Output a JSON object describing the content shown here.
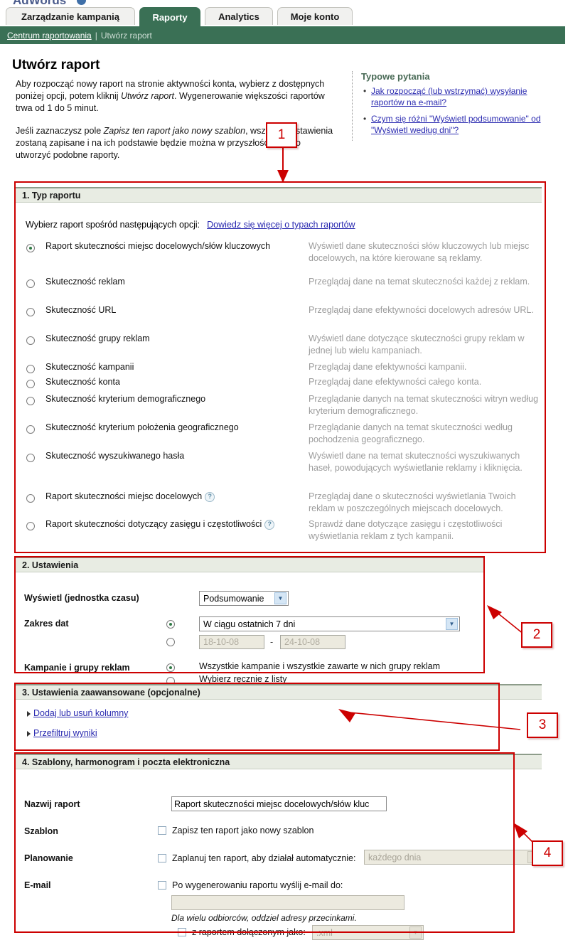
{
  "brand": {
    "logo_text": "AdWords"
  },
  "tabs": [
    {
      "label": "Zarządzanie kampanią",
      "active": false
    },
    {
      "label": "Raporty",
      "active": true
    },
    {
      "label": "Analytics",
      "active": false
    },
    {
      "label": "Moje konto",
      "active": false
    }
  ],
  "breadcrumb": {
    "link": "Centrum raportowania",
    "separator": "|",
    "current": "Utwórz raport"
  },
  "page": {
    "title": "Utwórz raport",
    "intro_p1_a": "Aby rozpocząć nowy raport na stronie aktywności konta, wybierz z dostępnych poniżej opcji, potem kliknij ",
    "intro_p1_em": "Utwórz raport",
    "intro_p1_b": ". Wygenerowanie większości raportów trwa od 1 do 5 minut.",
    "intro_p2_a": "Jeśli zaznaczysz pole ",
    "intro_p2_em": "Zapisz ten raport jako nowy szablon",
    "intro_p2_b": ", wszystkie ustawienia zostaną zapisane i na ich podstawie będzie można w przyszłości szybko utworzyć podobne raporty."
  },
  "faq": {
    "title": "Typowe pytania",
    "items": [
      "Jak rozpocząć (lub wstrzymać) wysyłanie raportów na e-mail?",
      "Czym się różni \"Wyświetl podsumowanie\" od \"Wyświetl według dni\"?"
    ]
  },
  "section1": {
    "header": "1. Typ raportu",
    "choose_text": "Wybierz raport spośród następujących opcji:",
    "choose_link": "Dowiedz się więcej o typach raportów",
    "options": [
      {
        "label": "Raport skuteczności miejsc docelowych/słów kluczowych",
        "desc": "Wyświetl dane skuteczności słów kluczowych lub miejsc docelowych, na które kierowane są reklamy.",
        "selected": true,
        "help": false
      },
      {
        "label": "Skuteczność reklam",
        "desc": "Przeglądaj dane na temat skuteczności każdej z reklam.",
        "selected": false,
        "help": false
      },
      {
        "label": "Skuteczność URL",
        "desc": "Przeglądaj dane efektywności docelowych adresów URL.",
        "selected": false,
        "help": false
      },
      {
        "label": "Skuteczność grupy reklam",
        "desc": "Wyświetl dane dotyczące skuteczności grupy reklam w jednej lub wielu kampaniach.",
        "selected": false,
        "help": false
      },
      {
        "label": "Skuteczność kampanii",
        "desc": "Przeglądaj dane efektywności kampanii.",
        "selected": false,
        "help": false
      },
      {
        "label": "Skuteczność konta",
        "desc": "Przeglądaj dane efektywności całego konta.",
        "selected": false,
        "help": false
      },
      {
        "label": "Skuteczność kryterium demograficznego",
        "desc": "Przeglądanie danych na temat skuteczności witryn według kryterium demograficznego.",
        "selected": false,
        "help": false
      },
      {
        "label": "Skuteczność kryterium położenia geograficznego",
        "desc": "Przeglądanie danych na temat skuteczności według pochodzenia geograficznego.",
        "selected": false,
        "help": false
      },
      {
        "label": "Skuteczność wyszukiwanego hasła",
        "desc": "Wyświetl dane na temat skuteczności wyszukiwanych haseł, powodujących wyświetlanie reklamy i kliknięcia.",
        "selected": false,
        "help": false
      },
      {
        "label": "Raport skuteczności miejsc docelowych",
        "desc": "Przeglądaj dane o skuteczności wyświetlania Twoich reklam w poszczególnych miejscach docelowych.",
        "selected": false,
        "help": true
      },
      {
        "label": "Raport skuteczności dotyczący zasięgu i częstotliwości",
        "desc": "Sprawdź dane dotyczące zasięgu i częstotliwości wyświetlania reklam z tych kampanii.",
        "selected": false,
        "help": true
      }
    ]
  },
  "section2": {
    "header": "2. Ustawienia",
    "display_label": "Wyświetl (jednostka czasu)",
    "display_value": "Podsumowanie",
    "date_label": "Zakres dat",
    "date_range_value": "W ciągu ostatnich 7 dni",
    "date_from": "18-10-08",
    "date_to": "24-10-08",
    "date_dash": "-",
    "campaign_label": "Kampanie i grupy reklam",
    "campaign_option_all": "Wszystkie kampanie i wszystkie zawarte w nich grupy reklam",
    "campaign_option_manual": "Wybierz ręcznie z listy"
  },
  "section3": {
    "header": "3. Ustawienia zaawansowane (opcjonalne)",
    "links": [
      "Dodaj lub usuń kolumny",
      "Przefiltruj wyniki"
    ]
  },
  "section4": {
    "header": "4. Szablony, harmonogram i poczta elektroniczna",
    "name_label": "Nazwij raport",
    "name_value": "Raport skuteczności miejsc docelowych/słów kluc",
    "template_label": "Szablon",
    "template_checkbox": "Zapisz ten raport jako nowy szablon",
    "schedule_label": "Planowanie",
    "schedule_checkbox": "Zaplanuj ten raport, aby działał automatycznie:",
    "schedule_select_value": "każdego dnia",
    "email_label": "E-mail",
    "email_checkbox": "Po wygenerowaniu raportu wyślij e-mail do:",
    "email_value": "",
    "email_note": "Dla wielu odbiorców, oddziel adresy przecinkami.",
    "attach_checkbox": "z raportem dołączonym jako:",
    "attach_select_value": ".xml"
  },
  "callouts": [
    {
      "number": "1"
    },
    {
      "number": "2"
    },
    {
      "number": "3"
    },
    {
      "number": "4"
    }
  ],
  "colors": {
    "green": "#3a7055",
    "panel_header": "#e8ece3",
    "link": "#2a2ab0",
    "annotation_red": "#cc0000",
    "muted_text": "#9b9b9b"
  }
}
